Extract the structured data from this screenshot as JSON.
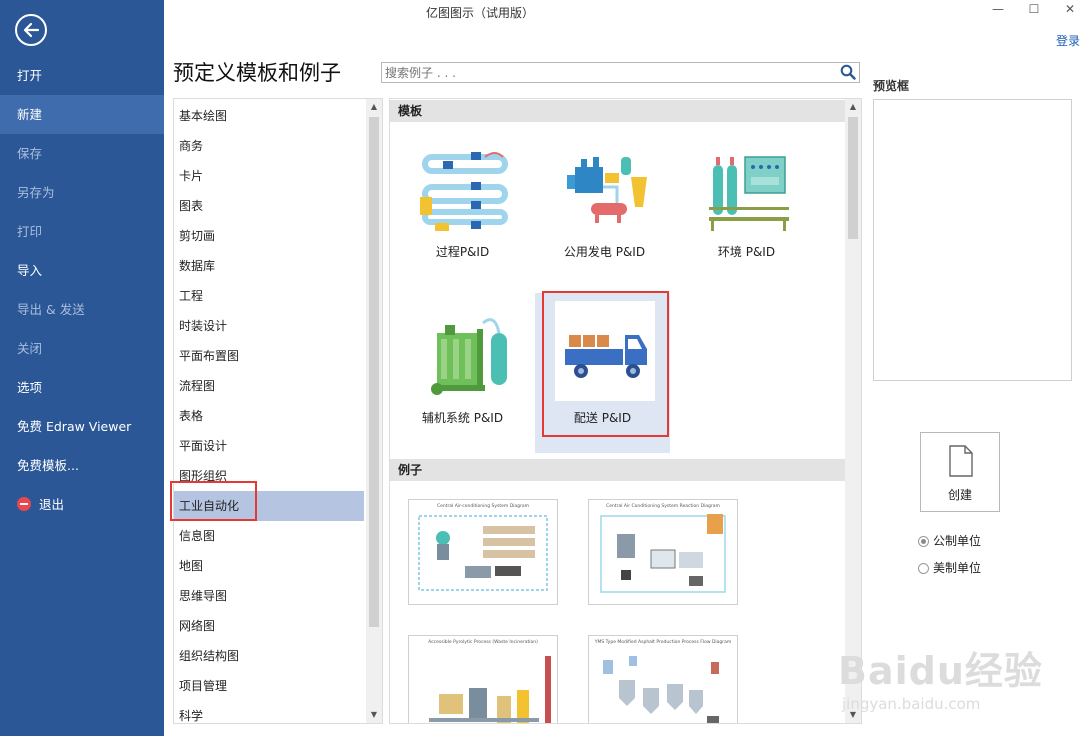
{
  "window": {
    "title": "亿图图示（试用版）",
    "login": "登录",
    "minimize": "—",
    "maximize": "☐",
    "close": "✕"
  },
  "sidebar": {
    "items": [
      {
        "label": "打开"
      },
      {
        "label": "新建"
      },
      {
        "label": "保存"
      },
      {
        "label": "另存为"
      },
      {
        "label": "打印"
      },
      {
        "label": "导入"
      },
      {
        "label": "导出 & 发送"
      },
      {
        "label": "关闭"
      },
      {
        "label": "选项"
      },
      {
        "label": "免费 Edraw Viewer"
      },
      {
        "label": "免费模板..."
      },
      {
        "label": "退出"
      }
    ]
  },
  "main": {
    "heading": "预定义模板和例子",
    "search": {
      "placeholder": "搜索例子 . . ."
    },
    "categories": [
      "基本绘图",
      "商务",
      "卡片",
      "图表",
      "剪切画",
      "数据库",
      "工程",
      "时装设计",
      "平面布置图",
      "流程图",
      "表格",
      "平面设计",
      "图形组织",
      "工业自动化",
      "信息图",
      "地图",
      "思维导图",
      "网络图",
      "组织结构图",
      "项目管理",
      "科学"
    ],
    "selected_category": "工业自动化",
    "templates_header": "模板",
    "templates": [
      {
        "label": "过程P&ID"
      },
      {
        "label": "公用发电 P&ID"
      },
      {
        "label": "环境 P&ID"
      },
      {
        "label": "辅机系统 P&ID"
      },
      {
        "label": "配送 P&ID"
      }
    ],
    "selected_template": "配送 P&ID",
    "examples_header": "例子",
    "examples": [
      {
        "title": "Central Air-conditioning System Diagram"
      },
      {
        "title": "Central Air Conditioning System Reaction Diagram"
      },
      {
        "title": "Accessible Pyrolytic Process (Waste Incineration)"
      },
      {
        "title": "YMS Type Modified Asphalt Production Process Flow Diagram"
      }
    ]
  },
  "preview": {
    "label": "预览框",
    "create_label": "创建",
    "units": [
      {
        "label": "公制单位",
        "selected": true
      },
      {
        "label": "美制单位",
        "selected": false
      }
    ]
  },
  "watermark": {
    "main": "Baidu经验",
    "sub": "jingyan.baidu.com"
  },
  "colors": {
    "sidebar": "#2b5797",
    "sidebar_active": "#3f6cad",
    "selection": "#b4c4e1",
    "highlight": "#e53935",
    "accent": "#1a5fb4"
  }
}
